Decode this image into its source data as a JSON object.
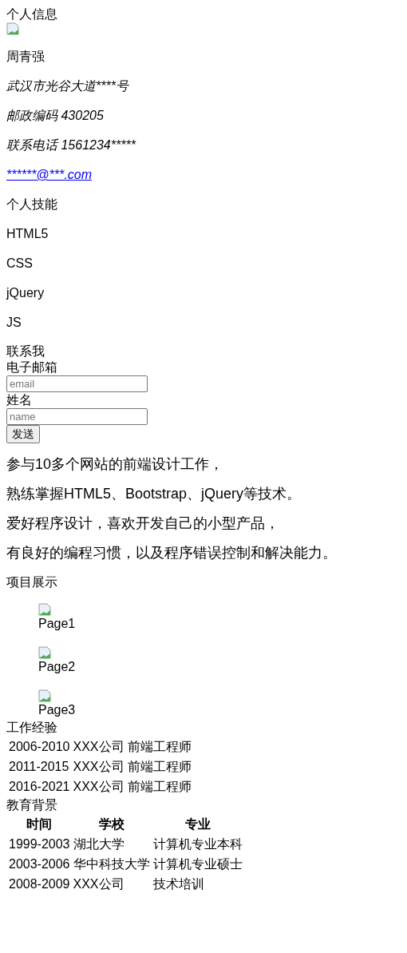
{
  "profile": {
    "heading": "个人信息",
    "name": "周青强",
    "address": "武汉市光谷大道****号",
    "postcode": "邮政编码 430205",
    "phone": "联系电话 1561234*****",
    "email": "******@***.com"
  },
  "skills": {
    "heading": "个人技能",
    "items": [
      "HTML5",
      "CSS",
      "jQuery",
      "JS"
    ]
  },
  "contact": {
    "heading": "联系我",
    "fields": [
      {
        "label": "电子邮箱",
        "placeholder": "email"
      },
      {
        "label": "姓名",
        "placeholder": "name"
      }
    ],
    "button": "发送"
  },
  "summary": [
    "参与10多个网站的前端设计工作，",
    "熟练掌握HTML5、Bootstrap、jQuery等技术。",
    "爱好程序设计，喜欢开发自己的小型产品，",
    "有良好的编程习惯，以及程序错误控制和解决能力。"
  ],
  "projects": {
    "heading": "项目展示",
    "items": [
      "Page1",
      "Page2",
      "Page3"
    ]
  },
  "work": {
    "heading": "工作经验",
    "rows": [
      [
        "2006-2010",
        "XXX公司",
        "前端工程师"
      ],
      [
        "2011-2015",
        "XXX公司",
        "前端工程师"
      ],
      [
        "2016-2021",
        "XXX公司",
        "前端工程师"
      ]
    ]
  },
  "education": {
    "heading": "教育背景",
    "columns": [
      "时间",
      "学校",
      "专业"
    ],
    "rows": [
      [
        "1999-2003",
        "湖北大学",
        "计算机专业本科"
      ],
      [
        "2003-2006",
        "华中科技大学",
        "计算机专业硕士"
      ],
      [
        "2008-2009",
        "XXX公司",
        "技术培训"
      ]
    ]
  }
}
